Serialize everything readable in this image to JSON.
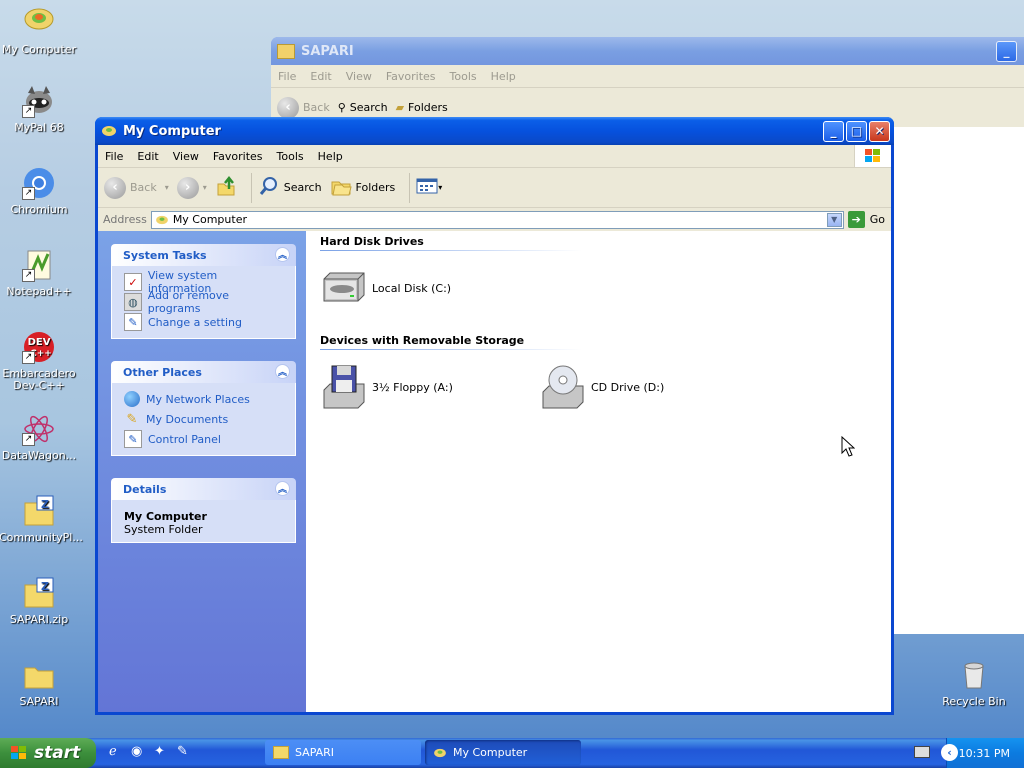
{
  "desktop": {
    "icons": [
      {
        "label": "My Computer"
      },
      {
        "label": "MyPal 68"
      },
      {
        "label": "Chromium"
      },
      {
        "label": "Notepad++"
      },
      {
        "label": "Embarcadero Dev-C++",
        "line1": "Embarcadero",
        "line2": "Dev-C++"
      },
      {
        "label": "DataWagon..."
      },
      {
        "label": "CommunityPl..."
      },
      {
        "label": "SAPARI.zip"
      },
      {
        "label": "SAPARI"
      },
      {
        "label": "Recycle Bin"
      }
    ],
    "dev_badge": "DEV\nC++"
  },
  "back_window": {
    "title": "SAPARI",
    "menu": [
      "File",
      "Edit",
      "View",
      "Favorites",
      "Tools",
      "Help"
    ],
    "toolbar": {
      "back": "Back",
      "search": "Search",
      "folders": "Folders"
    }
  },
  "window": {
    "title": "My Computer",
    "menu": [
      "File",
      "Edit",
      "View",
      "Favorites",
      "Tools",
      "Help"
    ],
    "toolbar": {
      "back": "Back",
      "search": "Search",
      "folders": "Folders"
    },
    "address": {
      "label": "Address",
      "value": "My Computer",
      "go": "Go"
    },
    "panes": {
      "system_tasks": {
        "title": "System Tasks",
        "items": [
          "View system information",
          "Add or remove programs",
          "Change a setting"
        ]
      },
      "other_places": {
        "title": "Other Places",
        "items": [
          "My Network Places",
          "My Documents",
          "Control Panel"
        ]
      },
      "details": {
        "title": "Details",
        "name": "My Computer",
        "type": "System Folder"
      }
    },
    "sections": {
      "hdd": {
        "title": "Hard Disk Drives",
        "drives": [
          "Local Disk (C:)"
        ]
      },
      "removable": {
        "title": "Devices with Removable Storage",
        "drives": [
          "3½ Floppy (A:)",
          "CD Drive (D:)"
        ]
      }
    }
  },
  "taskbar": {
    "start": "start",
    "items": [
      "SAPARI",
      "My Computer"
    ],
    "clock": "10:31 PM"
  },
  "colors": {
    "titlebar_blue": "#0651de",
    "pane_link": "#215dc6",
    "start_green": "#3c8f3c"
  }
}
